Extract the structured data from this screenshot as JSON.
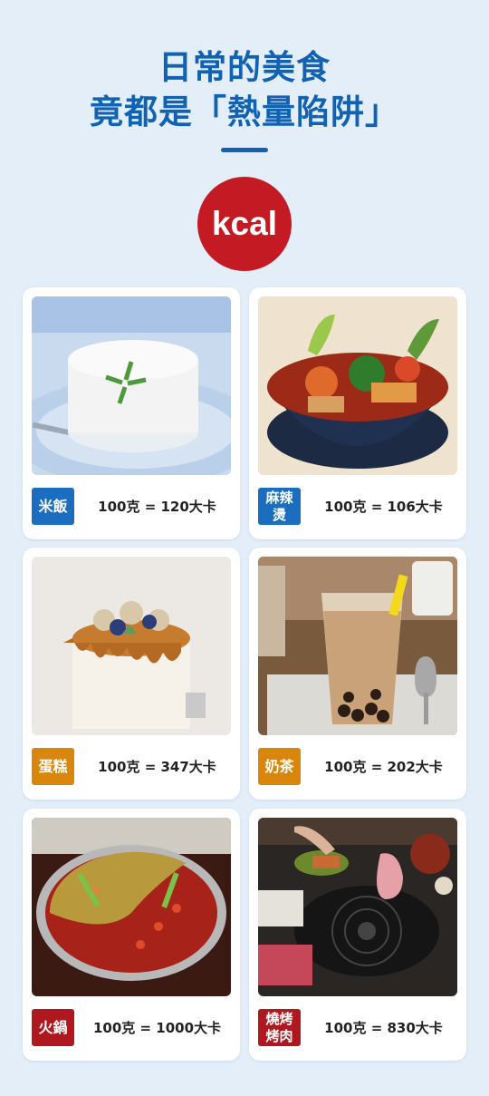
{
  "header": {
    "line1": "日常的美食",
    "line2": "竟都是「熱量陷阱」",
    "kcal": "kcal"
  },
  "colors": {
    "title": "#1262b3",
    "kcal_circle": "#c41a24",
    "badge_blue": "#1a6dbf",
    "badge_orange": "#d8860c",
    "badge_red": "#b0181f"
  },
  "foods": [
    {
      "label": "米飯",
      "calories": "100克 = 120大卡"
    },
    {
      "label": "麻辣燙",
      "calories": "100克 = 106大卡"
    },
    {
      "label": "蛋糕",
      "calories": "100克 = 347大卡"
    },
    {
      "label": "奶茶",
      "calories": "100克 = 202大卡"
    },
    {
      "label": "火鍋",
      "calories": "100克 = 1000大卡"
    },
    {
      "label": "燒烤烤肉",
      "calories": "100克 = 830大卡"
    }
  ]
}
